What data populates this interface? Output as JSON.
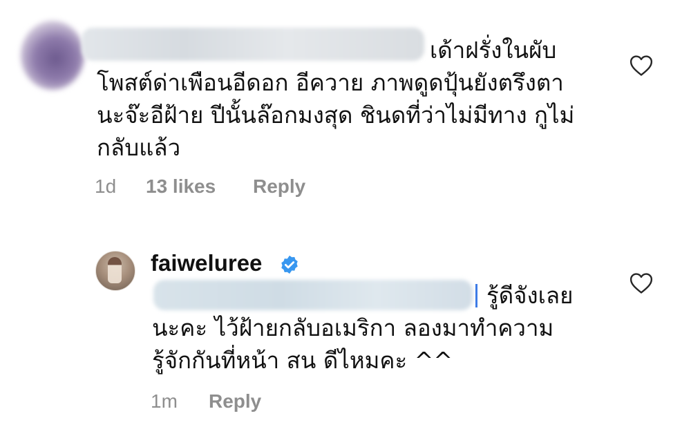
{
  "comments": [
    {
      "username": "",
      "lines": [
        "เด้าฝรั่งในผับ",
        "โพสต์ด่าเพือนอีดอก อีควาย ภาพดูดปุ้นยังตรึงตา",
        "นะจ๊ะอีฝ้าย  ปีนั้นล๊อกมงสุด ชินดที่ว่าไม่มีทาง กูไม่",
        "กลับแล้ว"
      ],
      "time": "1d",
      "likes": "13 likes",
      "reply": "Reply"
    },
    {
      "username": "faiweluree",
      "verified": true,
      "lines": [
        "รู้ดีจังเลย",
        "นะคะ ไว้ฝ้ายกลับอเมริกา ลองมาทำความ",
        "รู้จักกันที่หน้า สน ดีไหมคะ ^^"
      ],
      "time": "1m",
      "reply": "Reply"
    }
  ],
  "colors": {
    "meta": "#8e8e8e",
    "verified": "#3897f0",
    "text": "#111111"
  },
  "icons": {
    "like": "heart-outline-icon",
    "verified": "verified-badge-icon"
  }
}
